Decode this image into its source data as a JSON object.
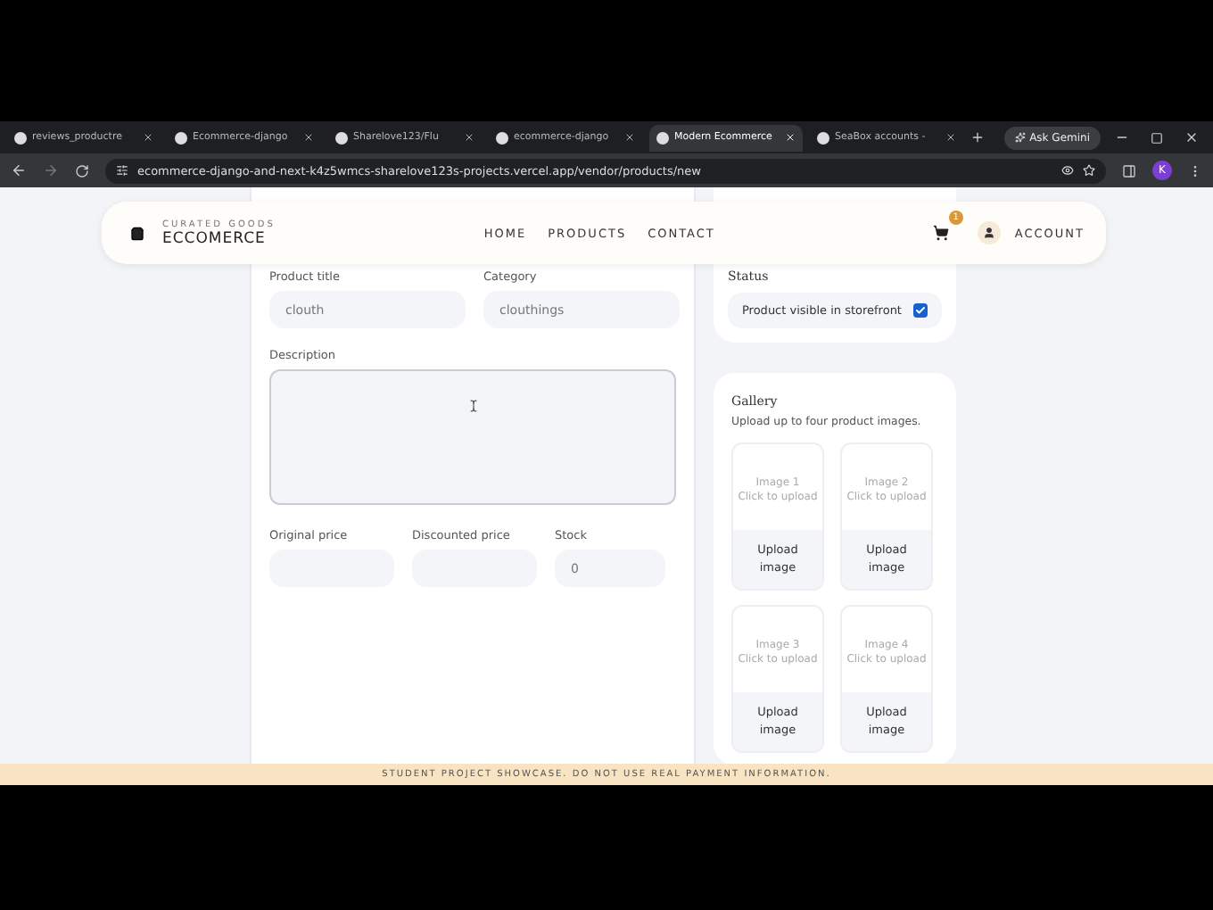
{
  "browser": {
    "tabs": [
      {
        "title": "reviews_productre",
        "selected": false
      },
      {
        "title": "Ecommerce-django",
        "selected": false
      },
      {
        "title": "Sharelove123/Flu",
        "selected": false
      },
      {
        "title": "ecommerce-django",
        "selected": false
      },
      {
        "title": "Modern Ecommerce",
        "selected": true
      },
      {
        "title": "SeaBox accounts -",
        "selected": false
      }
    ],
    "ask_button": "Ask Gemini",
    "url": "ecommerce-django-and-next-k4z5wmcs-sharelove123s-projects.vercel.app/vendor/products/new",
    "profile": "K"
  },
  "header": {
    "tagline": "CURATED GOODS",
    "brand": "ECCOMERCE",
    "nav": [
      "HOME",
      "PRODUCTS",
      "CONTACT"
    ],
    "cart_count": "1",
    "account": "ACCOUNT"
  },
  "form": {
    "fields": [
      {
        "label": "Product title",
        "value": "clouth"
      },
      {
        "label": "Category",
        "value": "clouthings"
      }
    ],
    "description": {
      "label": "Description"
    },
    "price_fields": [
      {
        "label": "Original price"
      },
      {
        "label": "Discounted price"
      },
      {
        "label": "Stock",
        "value": "0"
      }
    ]
  },
  "status": {
    "title": "Status",
    "label": "Product visible in storefront",
    "checked": true
  },
  "gallery": {
    "title": "Gallery",
    "subtitle": "Upload up to four product images.",
    "slots": [
      {
        "name": "Image 1",
        "hint": "Click to upload",
        "button": "Upload image"
      },
      {
        "name": "Image 2",
        "hint": "Click to upload",
        "button": "Upload image"
      },
      {
        "name": "Image 3",
        "hint": "Click to upload",
        "button": "Upload image"
      },
      {
        "name": "Image 4",
        "hint": "Click to upload",
        "button": "Upload image"
      }
    ]
  },
  "banner": "STUDENT PROJECT SHOWCASE. DO NOT USE REAL PAYMENT INFORMATION."
}
